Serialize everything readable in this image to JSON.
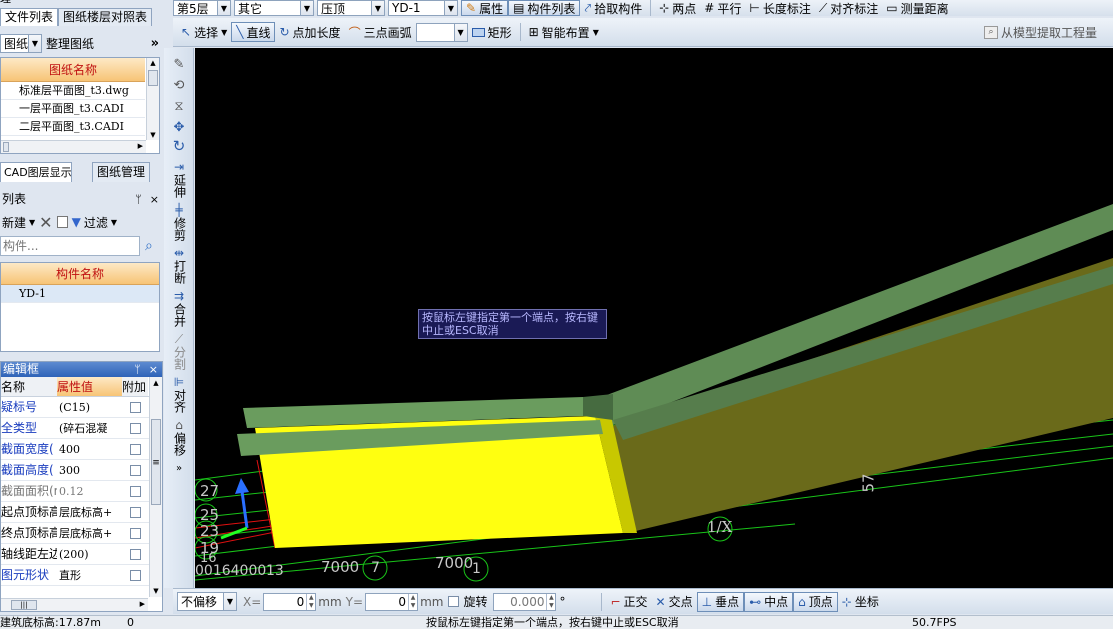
{
  "toolbar_top": {
    "floor": "第5层",
    "category": "其它",
    "type": "压顶",
    "component": "YD-1",
    "btn_properties": "属性",
    "btn_component_list": "构件列表",
    "btn_pick_component": "拾取构件",
    "btn_two_points": "两点",
    "btn_parallel": "平行",
    "btn_length_dim": "长度标注",
    "btn_aligned_dim": "对齐标注",
    "btn_measure_distance": "测量距离"
  },
  "toolbar_draw": {
    "select": "选择",
    "line": "直线",
    "point_extend": "点加长度",
    "three_point_arc": "三点画弧",
    "rectangle": "矩形",
    "smart_layout": "智能布置",
    "extract_from_model": "从模型提取工程量"
  },
  "drawing_panel": {
    "header_fragment": "理",
    "tabs": [
      "文件列表",
      "图纸楼层对照表"
    ],
    "sub_dropdown": "图纸",
    "btn_organize": "整理图纸",
    "more": "»",
    "column_header": "图纸名称",
    "rows": [
      "标准层平面图_t3.dwg",
      "一层平面图_t3.CADI",
      "二层平面图_t3.CADI"
    ],
    "bottom_tabs": [
      "CAD图层显示",
      "图纸管理"
    ]
  },
  "component_list": {
    "title": "列表",
    "pin": "ᛘ",
    "close": "×",
    "btn_new": "新建",
    "btn_filter": "过滤",
    "search_placeholder": "构件...",
    "column_header": "构件名称",
    "rows": [
      "YD-1"
    ]
  },
  "property_editor": {
    "title": "编辑框",
    "pin": "ᛘ",
    "close": "×",
    "col_name": "名称",
    "col_value": "属性值",
    "col_extra": "附加",
    "rows": [
      {
        "name": "疑标号",
        "value": "(C15)",
        "name_color": "#1a3dbf"
      },
      {
        "name": "全类型",
        "value": "(碎石混凝",
        "name_color": "#1a3dbf"
      },
      {
        "name": "截面宽度(",
        "value": "400",
        "name_color": "#1a3dbf"
      },
      {
        "name": "截面高度(",
        "value": "300",
        "name_color": "#1a3dbf"
      },
      {
        "name": "截面面积(m",
        "value": "0.12",
        "name_color": "#777777"
      },
      {
        "name": "起点顶标高",
        "value": "层底标高+",
        "name_color": "#000000"
      },
      {
        "name": "终点顶标高",
        "value": "层底标高+",
        "name_color": "#000000"
      },
      {
        "name": "轴线距左边",
        "value": "(200)",
        "name_color": "#000000"
      },
      {
        "name": "图元形状",
        "value": "直形",
        "name_color": "#1a3dbf"
      }
    ]
  },
  "vertical_toolbar": {
    "extend": "延伸",
    "trim": "修剪",
    "break": "打断",
    "merge": "合并",
    "split": "分割",
    "align": "对齐",
    "offset": "偏移"
  },
  "viewport": {
    "tooltip": "按鼠标左键指定第一个端点，按右键中止或ESC取消",
    "labels": {
      "axis_1x": "1/X",
      "num_57": "57",
      "dim_7000a": "7000",
      "dim_7000b": "7000",
      "num_7": "7",
      "num_1": "1",
      "num_27": "27",
      "num_25": "25",
      "num_23": "23",
      "num_19": "19",
      "num_16": "16",
      "dim_left": "00164000",
      "num_13": "13"
    }
  },
  "bottom_toolbar": {
    "offset_mode": "不偏移",
    "x_label": "X=",
    "x_value": "0",
    "unit_mm": "mm",
    "y_label": "Y=",
    "y_value": "0",
    "rotate": "旋转",
    "rotate_value": "0.000",
    "degree": "°",
    "orthogonal": "正交",
    "intersection": "交点",
    "perpendicular": "垂点",
    "midpoint": "中点",
    "vertex": "顶点",
    "coordinate": "坐标"
  },
  "status_bar": {
    "floor_elevation": "建筑底标高:17.87m",
    "value": "0",
    "message": "按鼠标左键指定第一个端点，按右键中止或ESC取消",
    "fps": "50.7FPS"
  },
  "colors": {
    "viewport_bg": "#000000",
    "beam_top": "#5f8c55",
    "beam_side": "#6a6a1a",
    "yellow_face": "#ffff10",
    "grid_line": "#19c419",
    "tooltip_bg": "#1a1a55",
    "header_orange": "#f7c476"
  }
}
